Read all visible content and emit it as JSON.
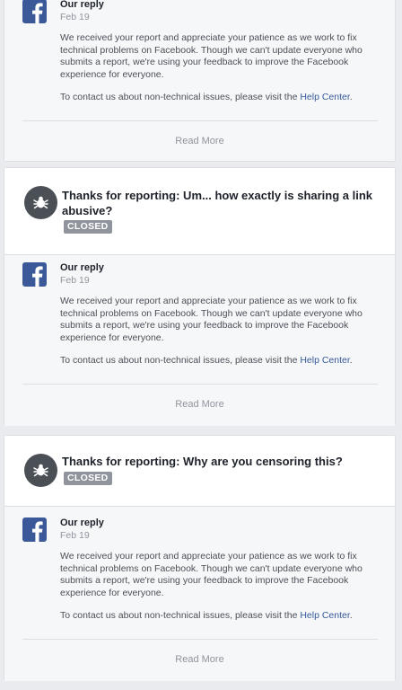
{
  "reports": [
    {
      "title": "",
      "status": "",
      "reply": {
        "author": "Our reply",
        "date": "Feb 19",
        "body": "We received your report and appreciate your patience as we work to fix technical problems on Facebook. Though we can't update everyone who submits a report, we're using your feedback to improve the Facebook experience for everyone.",
        "contact_prefix": "To contact us about non-technical issues, please visit the ",
        "contact_link": "Help Center",
        "contact_suffix": "."
      },
      "read_more": "Read More"
    },
    {
      "title": "Thanks for reporting: Um... how exactly is sharing a link abusive?",
      "status": "CLOSED",
      "reply": {
        "author": "Our reply",
        "date": "Feb 19",
        "body": "We received your report and appreciate your patience as we work to fix technical problems on Facebook. Though we can't update everyone who submits a report, we're using your feedback to improve the Facebook experience for everyone.",
        "contact_prefix": "To contact us about non-technical issues, please visit the ",
        "contact_link": "Help Center",
        "contact_suffix": "."
      },
      "read_more": "Read More"
    },
    {
      "title": "Thanks for reporting: Why are you censoring this?",
      "status": "CLOSED",
      "reply": {
        "author": "Our reply",
        "date": "Feb 19",
        "body": "We received your report and appreciate your patience as we work to fix technical problems on Facebook. Though we can't update everyone who submits a report, we're using your feedback to improve the Facebook experience for everyone.",
        "contact_prefix": "To contact us about non-technical issues, please visit the ",
        "contact_link": "Help Center",
        "contact_suffix": "."
      },
      "read_more": "Read More"
    }
  ],
  "colors": {
    "brand": "#3b5998",
    "link": "#365899",
    "badge": "#90949c",
    "page_bg": "#e9ebee"
  },
  "icons": [
    "facebook-logo-icon",
    "bug-icon"
  ]
}
